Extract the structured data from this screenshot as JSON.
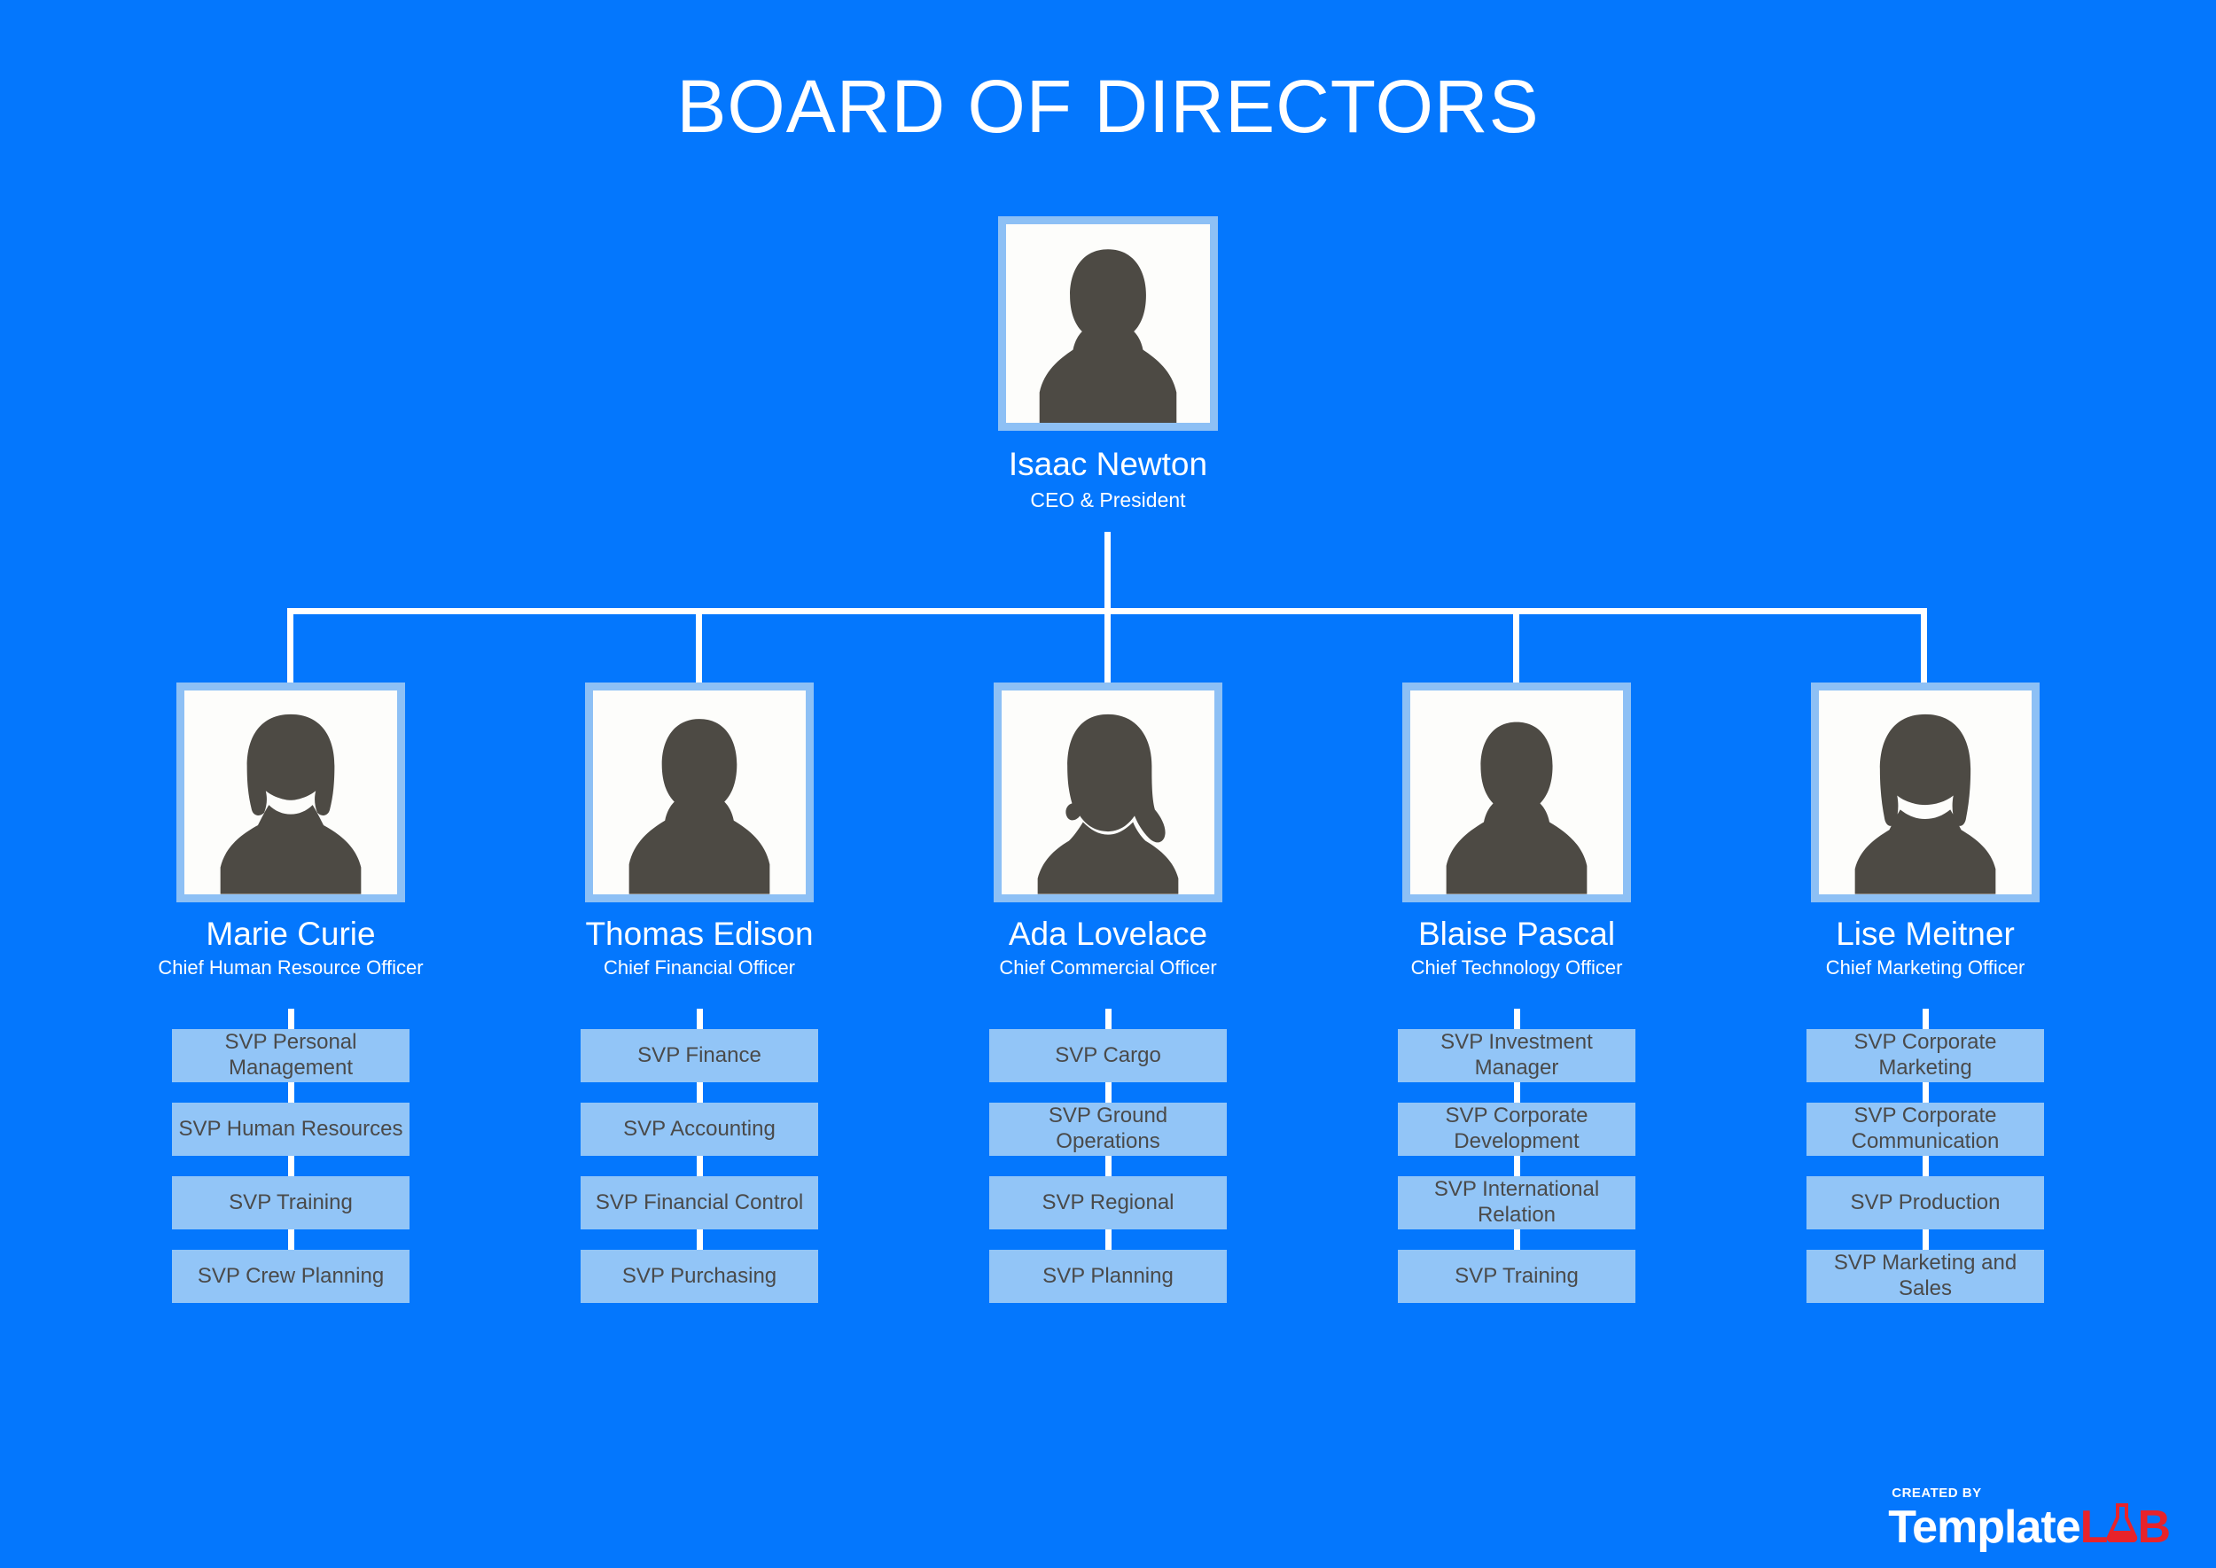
{
  "title": "BOARD OF DIRECTORS",
  "background_color": "#0477FD",
  "box_color": "#92C5F7",
  "box_text_color": "#4A4A4A",
  "frame_color": "#8DC0F5",
  "connector_color": "#FFFFFF",
  "ceo": {
    "name": "Isaac Newton",
    "title": "CEO & President",
    "avatar": "male-silhouette-avatar"
  },
  "executives": [
    {
      "name": "Marie Curie",
      "title": "Chief Human Resource Officer",
      "avatar": "female-bob-silhouette-avatar",
      "reports": [
        "SVP Personal Management",
        "SVP Human Resources",
        "SVP Training",
        "SVP Crew Planning"
      ]
    },
    {
      "name": "Thomas Edison",
      "title": "Chief Financial Officer",
      "avatar": "male-silhouette-avatar",
      "reports": [
        "SVP Finance",
        "SVP Accounting",
        "SVP Financial Control",
        "SVP Purchasing"
      ]
    },
    {
      "name": "Ada Lovelace",
      "title": "Chief Commercial Officer",
      "avatar": "female-ponytail-silhouette-avatar",
      "reports": [
        "SVP Cargo",
        "SVP Ground Operations",
        "SVP Regional",
        "SVP Planning"
      ]
    },
    {
      "name": "Blaise Pascal",
      "title": "Chief Technology Officer",
      "avatar": "male-short-hair-silhouette-avatar",
      "reports": [
        "SVP Investment Manager",
        "SVP Corporate Development",
        "SVP International Relation",
        "SVP Training"
      ]
    },
    {
      "name": "Lise Meitner",
      "title": "Chief Marketing Officer",
      "avatar": "female-long-hair-silhouette-avatar",
      "reports": [
        "SVP Corporate Marketing",
        "SVP Corporate Communication",
        "SVP Production",
        "SVP Marketing and Sales"
      ]
    }
  ],
  "logo": {
    "created_by": "CREATED BY",
    "word_template": "Template",
    "word_l": "L",
    "word_b": "B",
    "flask_letter": "A",
    "white": "#FFFFFF",
    "red": "#E8232A"
  }
}
